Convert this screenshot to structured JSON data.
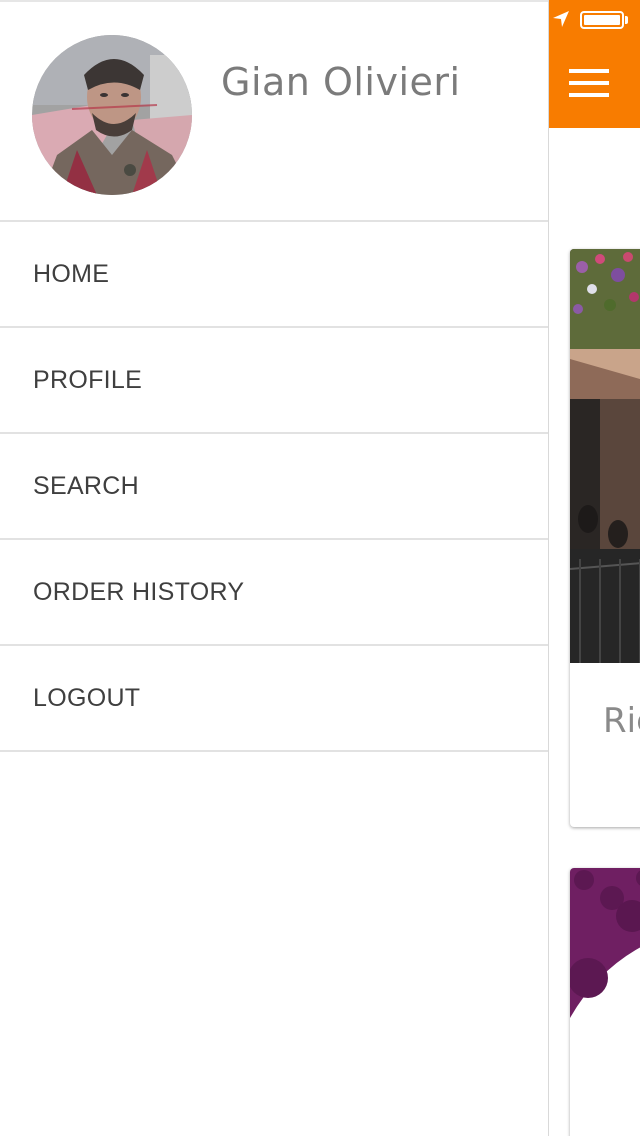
{
  "user": {
    "name": "Gian Olivieri"
  },
  "menu": {
    "items": [
      {
        "id": "home",
        "label": "HOME"
      },
      {
        "id": "profile",
        "label": "PROFILE"
      },
      {
        "id": "search",
        "label": "SEARCH"
      },
      {
        "id": "order-history",
        "label": "ORDER HISTORY"
      },
      {
        "id": "logout",
        "label": "LOGOUT"
      }
    ]
  },
  "main": {
    "cards": [
      {
        "title": "Ric"
      }
    ]
  },
  "status_bar": {
    "icons": [
      "location-arrow-icon",
      "battery-icon"
    ],
    "battery_level": 1.0
  },
  "icons": {
    "menu_toggle": "hamburger-icon"
  },
  "colors": {
    "accent": "#f87c00",
    "menu_text": "#3f3f3f",
    "name_text": "#7b7b7b",
    "divider": "#e2e2e2"
  }
}
